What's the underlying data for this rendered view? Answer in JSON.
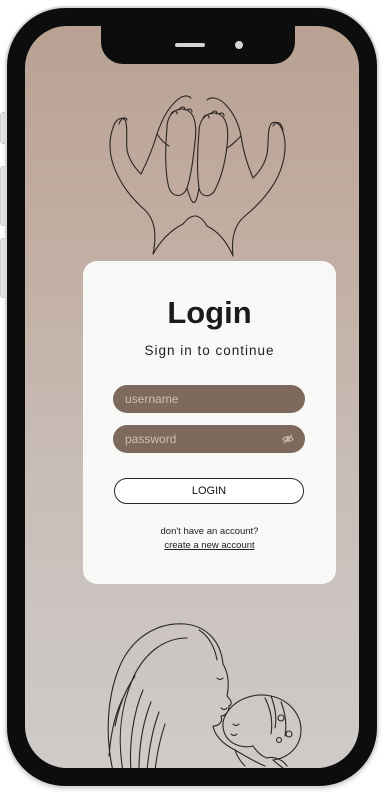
{
  "login_card": {
    "title": "Login",
    "subtitle": "Sign in to continue",
    "username_placeholder": "username",
    "password_placeholder": "password",
    "login_button": "LOGIN",
    "no_account_text": "don't have an account?",
    "create_account_link": "create a new account"
  },
  "icons": {
    "password_toggle": "eye-off-icon",
    "top_illustration": "baby-feet-in-hands",
    "bottom_illustration": "mother-holding-baby"
  },
  "colors": {
    "field_fill": "#7d6a5d",
    "field_text": "#cdbfb4",
    "background_top": "#b9a294",
    "background_bottom": "#cfcbc9",
    "card": "#f8f8f7"
  }
}
